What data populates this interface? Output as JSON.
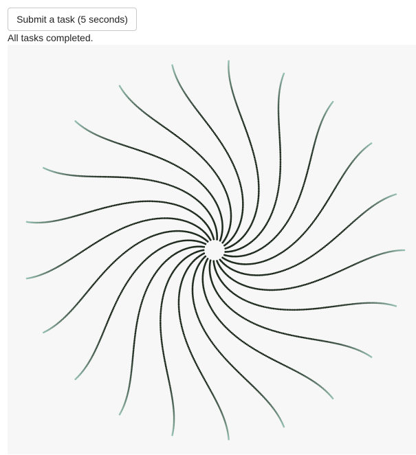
{
  "controls": {
    "submit_label": "Submit a task (5 seconds)"
  },
  "status": {
    "message": "All tasks completed."
  },
  "visualization": {
    "background": "#f7f7f7",
    "dot_color_inner": "#1e2a1e",
    "dot_color_outer": "#96bfb0",
    "arm_count": 21
  }
}
